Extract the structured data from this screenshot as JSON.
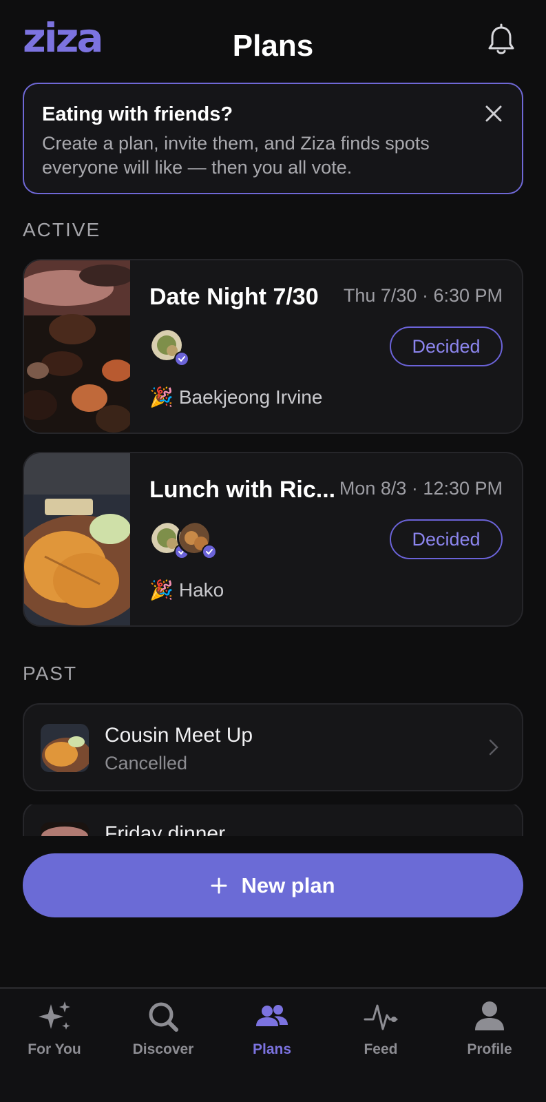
{
  "app": {
    "logo": "ziza",
    "title": "Plans"
  },
  "icons": {
    "bell": "bell-icon",
    "close": "close-icon",
    "chevron": "chevron-right-icon",
    "plus": "plus-icon"
  },
  "colors": {
    "accent": "#6b6bd6",
    "accent_text": "#7c73e0",
    "background": "#0e0e0f",
    "card": "#161618"
  },
  "banner": {
    "title": "Eating with friends?",
    "text": "Create a plan, invite them, and Ziza finds spots everyone will like — then you all vote."
  },
  "sections": {
    "active": "ACTIVE",
    "past": "PAST"
  },
  "active_plans": [
    {
      "title": "Date Night 7/30",
      "time": "Thu 7/30 · 6:30 PM",
      "status": "Decided",
      "venue_emoji": "🎉",
      "venue": "Baekjeong Irvine"
    },
    {
      "title": "Lunch with Ric...",
      "time": "Mon 8/3 · 12:30 PM",
      "status": "Decided",
      "venue_emoji": "🎉",
      "venue": "Hako"
    }
  ],
  "past_plans": [
    {
      "name": "Cousin Meet Up",
      "status": "Cancelled"
    },
    {
      "name": "Friday dinner",
      "status": ""
    }
  ],
  "new_plan_button": "New plan",
  "nav": [
    {
      "label": "For You",
      "icon": "sparkles-icon",
      "active": false
    },
    {
      "label": "Discover",
      "icon": "search-icon",
      "active": false
    },
    {
      "label": "Plans",
      "icon": "people-icon",
      "active": true
    },
    {
      "label": "Feed",
      "icon": "activity-icon",
      "active": false
    },
    {
      "label": "Profile",
      "icon": "person-icon",
      "active": false
    }
  ]
}
